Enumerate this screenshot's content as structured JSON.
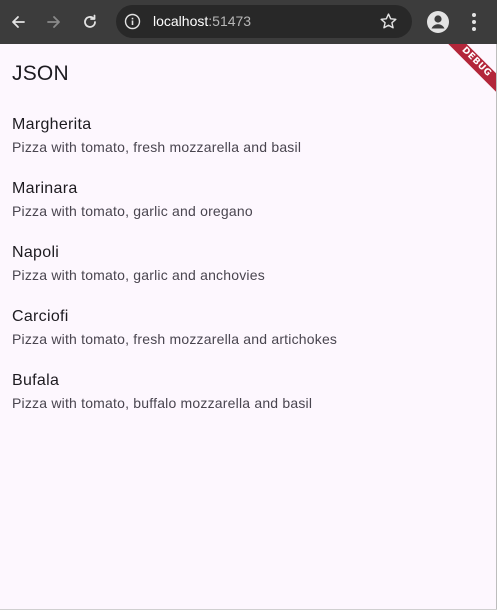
{
  "browser": {
    "url_host": "localhost",
    "url_port": ":51473",
    "icons": {
      "back": "arrow-left-icon",
      "forward": "arrow-right-icon",
      "reload": "reload-icon",
      "site_info": "info-icon",
      "bookmark": "star-icon",
      "profile": "profile-icon",
      "menu": "kebab-menu-icon"
    }
  },
  "app": {
    "title": "JSON",
    "debug_banner": "DEBUG",
    "items": [
      {
        "title": "Margherita",
        "subtitle": "Pizza with tomato, fresh mozzarella and basil"
      },
      {
        "title": "Marinara",
        "subtitle": "Pizza with tomato, garlic and oregano"
      },
      {
        "title": "Napoli",
        "subtitle": "Pizza with tomato, garlic and anchovies"
      },
      {
        "title": "Carciofi",
        "subtitle": "Pizza with tomato, fresh mozzarella and artichokes"
      },
      {
        "title": "Bufala",
        "subtitle": "Pizza with tomato, buffalo mozzarella and basil"
      }
    ]
  },
  "colors": {
    "browser_bar": "#3c3c3c",
    "omnibox": "#282828",
    "background": "#fdf7fe",
    "debug_ribbon": "#b3263a"
  }
}
